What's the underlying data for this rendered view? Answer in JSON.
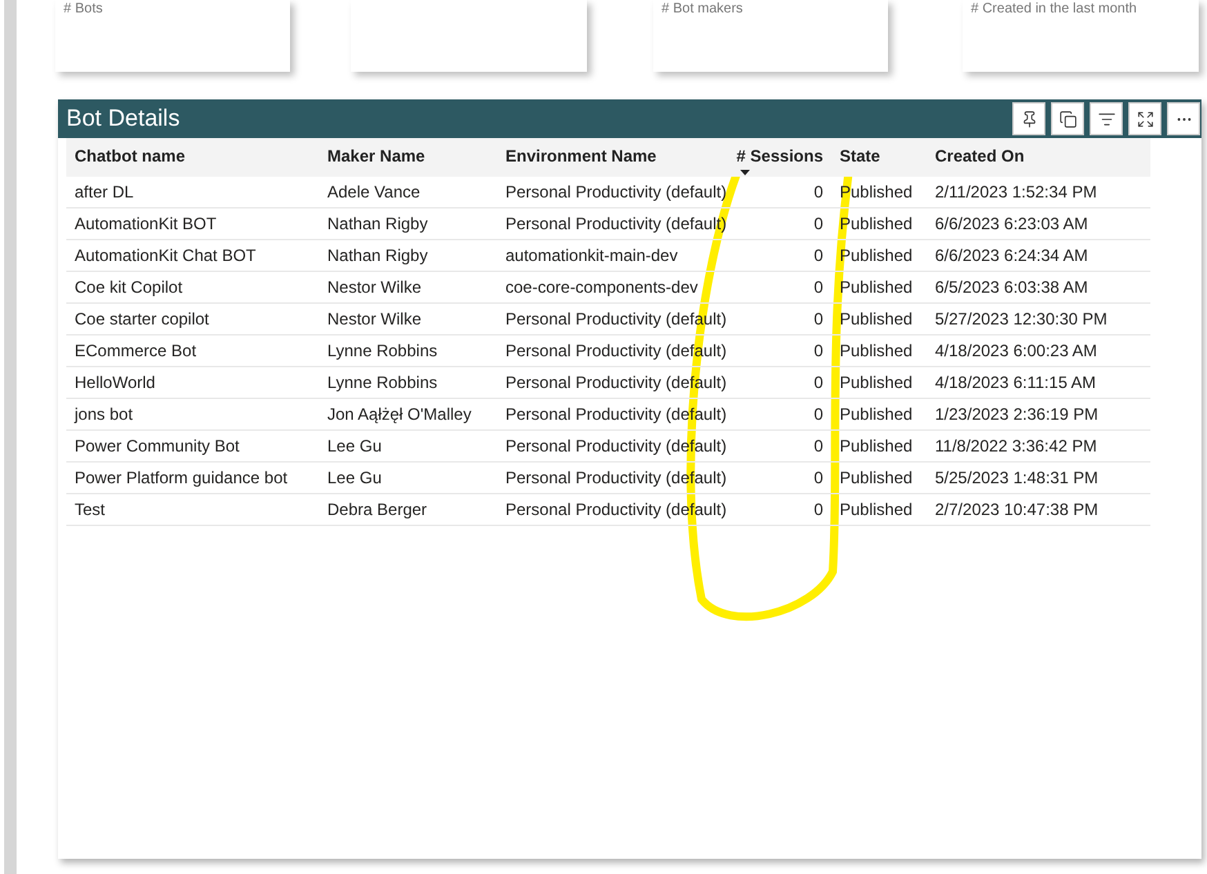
{
  "cards": [
    {
      "kind": "kpi",
      "label": "# Bots"
    },
    {
      "kind": "kpi"
    },
    {
      "kind": "kpi",
      "label": "# Bot makers"
    },
    {
      "kind": "kpi",
      "label": "# Created in the last month"
    }
  ],
  "visual": {
    "title": "Bot Details"
  },
  "table": {
    "columns": [
      {
        "label": "Chatbot name",
        "sorted": false
      },
      {
        "label": "Maker Name",
        "sorted": false
      },
      {
        "label": "Environment Name",
        "sorted": false
      },
      {
        "label": "# Sessions",
        "sorted": true
      },
      {
        "label": "State",
        "sorted": false
      },
      {
        "label": "Created On",
        "sorted": false
      }
    ],
    "rows": [
      [
        "after DL",
        "Adele Vance",
        "Personal Productivity (default)",
        "0",
        "Published",
        "2/11/2023 1:52:34 PM"
      ],
      [
        "AutomationKit BOT",
        "Nathan Rigby",
        "Personal Productivity (default)",
        "0",
        "Published",
        "6/6/2023 6:23:03 AM"
      ],
      [
        "AutomationKit Chat BOT",
        "Nathan Rigby",
        "automationkit-main-dev",
        "0",
        "Published",
        "6/6/2023 6:24:34 AM"
      ],
      [
        "Coe kit Copilot",
        "Nestor Wilke",
        "coe-core-components-dev",
        "0",
        "Published",
        "6/5/2023 6:03:38 AM"
      ],
      [
        "Coe starter copilot",
        "Nestor Wilke",
        "Personal Productivity (default)",
        "0",
        "Published",
        "5/27/2023 12:30:30 PM"
      ],
      [
        "ECommerce Bot",
        "Lynne Robbins",
        "Personal Productivity (default)",
        "0",
        "Published",
        "4/18/2023 6:00:23 AM"
      ],
      [
        "HelloWorld",
        "Lynne Robbins",
        "Personal Productivity (default)",
        "0",
        "Published",
        "4/18/2023 6:11:15 AM"
      ],
      [
        "jons bot",
        "Jon Aąłżęł O'Malley",
        "Personal Productivity (default)",
        "0",
        "Published",
        "1/23/2023 2:36:19 PM"
      ],
      [
        "Power Community Bot",
        "Lee Gu",
        "Personal Productivity (default)",
        "0",
        "Published",
        "11/8/2022 3:36:42 PM"
      ],
      [
        "Power Platform guidance bot",
        "Lee Gu",
        "Personal Productivity (default)",
        "0",
        "Published",
        "5/25/2023 1:48:31 PM"
      ],
      [
        "Test",
        "Debra Berger",
        "Personal Productivity (default)",
        "0",
        "Published",
        "2/7/2023 10:47:38 PM"
      ]
    ]
  }
}
